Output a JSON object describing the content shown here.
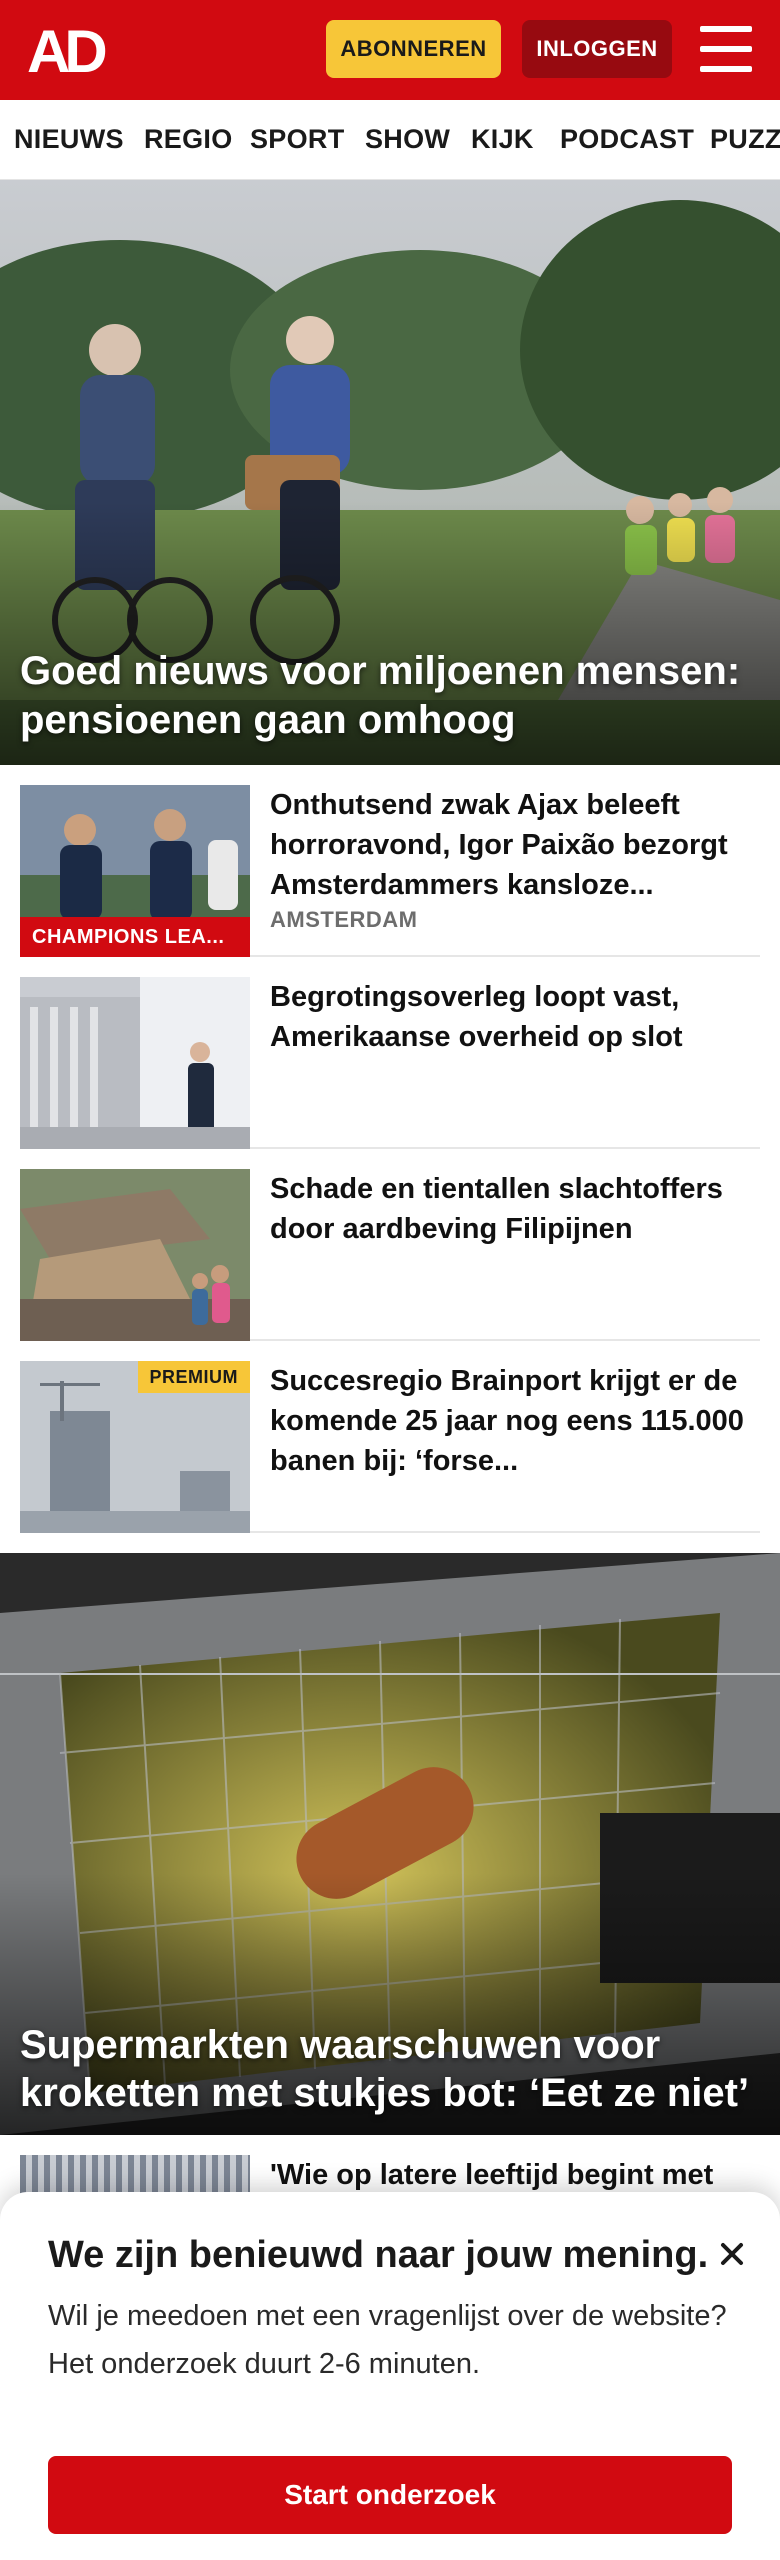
{
  "header": {
    "logo_text": "AD",
    "subscribe_label": "ABONNEREN",
    "login_label": "INLOGGEN",
    "menu_icon": "hamburger-menu-icon",
    "brand_color": "#d10a11",
    "accent_color": "#f7c638"
  },
  "nav": {
    "items": [
      "NIEUWS",
      "REGIO",
      "SPORT",
      "SHOW",
      "KIJK",
      "PODCAST",
      "PUZZ"
    ]
  },
  "hero": {
    "title": "Goed nieuws voor miljoenen mensen: pensioenen gaan omhoog"
  },
  "articles": [
    {
      "title": "Onthutsend zwak Ajax beleeft horroravond, Igor Paixão bezorgt Amsterdammers kansloze...",
      "location": "AMSTERDAM",
      "category_badge": "CHAMPIONS LEA..."
    },
    {
      "title": "Begrotingsoverleg loopt vast, Amerikaanse overheid op slot"
    },
    {
      "title": "Schade en tientallen slachtof­fers door aardbeving Filipijnen"
    },
    {
      "title": "Succesregio Brainport krijgt er de komende 25 jaar nog eens 115.000 banen bij: ‘forse...",
      "premium_badge": "PREMIUM"
    }
  ],
  "hero2": {
    "title": "Supermarkten waarschuwen voor kroketten met stukjes bot: ‘Eet ze niet’"
  },
  "partial_article": {
    "title": "'Wie op latere leeftijd begint met"
  },
  "survey": {
    "title": "We zijn benieuwd naar jouw mening.",
    "line1": "Wil je meedoen met een vragenlijst over de website?",
    "line2": "Het onderzoek duurt 2-6 minuten.",
    "button_label": "Start onderzoek",
    "close_icon": "close-icon"
  }
}
